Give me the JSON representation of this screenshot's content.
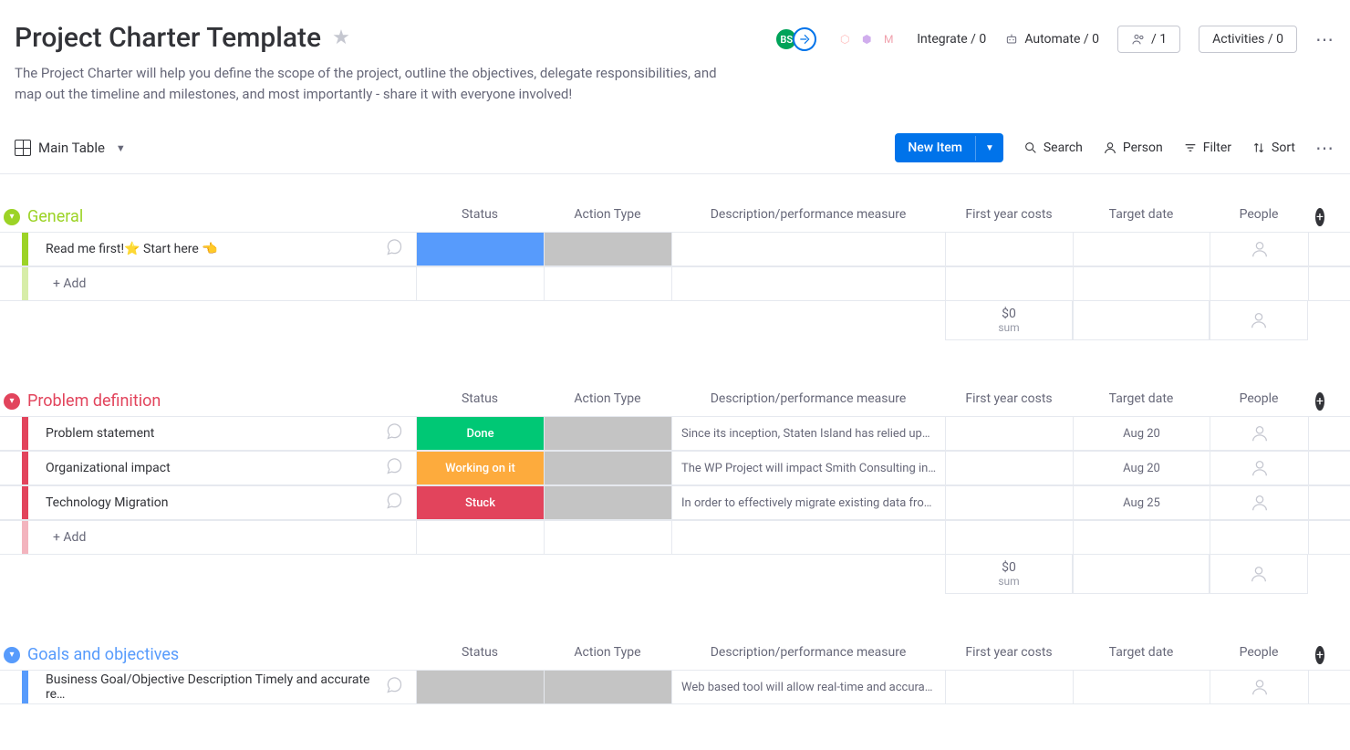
{
  "page": {
    "title": "Project Charter Template",
    "description": "The Project Charter will help you define the scope of the project, outline the objectives, delegate responsibilities, and map out the timeline and milestones, and most importantly - share it with everyone involved!"
  },
  "header": {
    "avatar_initials": "BS",
    "integrate": "Integrate / 0",
    "automate": "Automate / 0",
    "members": "/ 1",
    "activities": "Activities / 0"
  },
  "toolbar": {
    "view_name": "Main Table",
    "new_item": "New Item",
    "search": "Search",
    "person": "Person",
    "filter": "Filter",
    "sort": "Sort"
  },
  "columns": {
    "status": "Status",
    "action_type": "Action Type",
    "desc": "Description/performance measure",
    "costs": "First year costs",
    "target": "Target date",
    "people": "People"
  },
  "add_label": "+ Add",
  "groups": [
    {
      "id": "general",
      "title": "General",
      "color": "#9cd326",
      "rows": [
        {
          "name": "Read me first!⭐ Start here 👈",
          "status": "",
          "status_bg": "#579bfc",
          "action_bg": "#c4c4c4",
          "desc": "",
          "date": ""
        }
      ],
      "footer": {
        "costs": "$0",
        "sub": "sum"
      }
    },
    {
      "id": "problem",
      "title": "Problem definition",
      "color": "#e2445c",
      "rows": [
        {
          "name": "Problem statement",
          "status": "Done",
          "status_bg": "#00c875",
          "action_bg": "#c4c4c4",
          "desc": "Since its inception, Staten Island has relied up…",
          "date": "Aug 20"
        },
        {
          "name": "Organizational impact",
          "status": "Working on it",
          "status_bg": "#fdab3d",
          "action_bg": "#c4c4c4",
          "desc": "The WP Project will impact Smith Consulting in…",
          "date": "Aug 20"
        },
        {
          "name": "Technology Migration",
          "status": "Stuck",
          "status_bg": "#e2445c",
          "action_bg": "#c4c4c4",
          "desc": "In order to effectively migrate existing data fro…",
          "date": "Aug 25"
        }
      ],
      "footer": {
        "costs": "$0",
        "sub": "sum"
      }
    },
    {
      "id": "goals",
      "title": "Goals and objectives",
      "color": "#579bfc",
      "rows": [
        {
          "name": "Business Goal/Objective Description Timely and accurate re…",
          "status": "",
          "status_bg": "#c4c4c4",
          "action_bg": "#c4c4c4",
          "desc": "Web based tool will allow real-time and accura…",
          "date": ""
        }
      ]
    }
  ]
}
